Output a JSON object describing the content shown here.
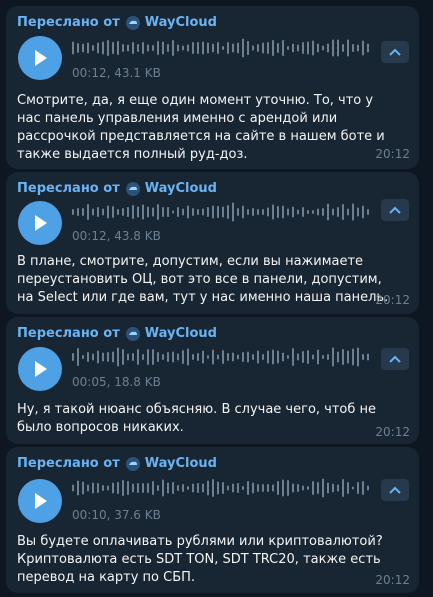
{
  "colors": {
    "background": "#0e1621",
    "bubble": "#182533",
    "accent": "#6ab3f3",
    "play_button": "#4fa1e6",
    "wave_played": "#6d8091",
    "meta_text": "#6d8091"
  },
  "messages": [
    {
      "forward_prefix": "Переслано от",
      "forward_source": "WayCloud",
      "voice_meta": "00:12, 43.1 KB",
      "text": "Смотрите, да, я еще один момент уточню. То, что у нас панель управления именно с арендой или рассрочкой представляется на сайте в нашем боте и также выдается полный руд-доз.",
      "time": "20:12"
    },
    {
      "forward_prefix": "Переслано от",
      "forward_source": "WayCloud",
      "voice_meta": "00:12, 43.8 KB",
      "text": "В плане, смотрите, допустим, если вы нажимаете переустановить ОЦ, вот это все в панели, допустим, на Select или где вам, тут у нас именно наша панель.",
      "time": "20:12"
    },
    {
      "forward_prefix": "Переслано от",
      "forward_source": "WayCloud",
      "voice_meta": "00:05, 18.8 KB",
      "text": "Ну, я такой нюанс объясняю. В случае чего, чтоб не было вопросов никаких.",
      "time": "20:12"
    },
    {
      "forward_prefix": "Переслано от",
      "forward_source": "WayCloud",
      "voice_meta": "00:10, 37.6 KB",
      "text": "Вы будете оплачивать рублями или криптовалютой? Криптовалюта есть SDT TON, SDT TRC20, также есть перевод на карту по СБП.",
      "time": "20:12"
    }
  ]
}
